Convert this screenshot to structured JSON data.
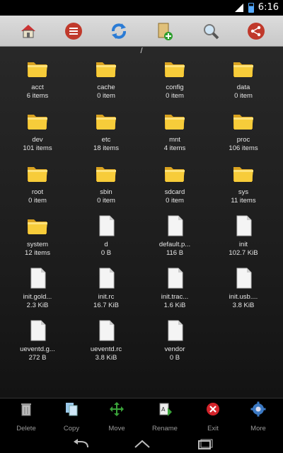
{
  "status": {
    "signal": "3G",
    "time": "6:16"
  },
  "toolbar": {
    "icons": [
      "home-icon",
      "menu-icon",
      "refresh-icon",
      "add-file-icon",
      "search-icon",
      "share-icon"
    ]
  },
  "path": "/",
  "items": [
    {
      "name": "acct",
      "info": "6 items",
      "type": "folder"
    },
    {
      "name": "cache",
      "info": "0 item",
      "type": "folder"
    },
    {
      "name": "config",
      "info": "0 item",
      "type": "folder"
    },
    {
      "name": "data",
      "info": "0 item",
      "type": "folder"
    },
    {
      "name": "dev",
      "info": "101 items",
      "type": "folder"
    },
    {
      "name": "etc",
      "info": "18 items",
      "type": "folder"
    },
    {
      "name": "mnt",
      "info": "4 items",
      "type": "folder"
    },
    {
      "name": "proc",
      "info": "106 items",
      "type": "folder"
    },
    {
      "name": "root",
      "info": "0 item",
      "type": "folder"
    },
    {
      "name": "sbin",
      "info": "0 item",
      "type": "folder"
    },
    {
      "name": "sdcard",
      "info": "0 item",
      "type": "folder"
    },
    {
      "name": "sys",
      "info": "11 items",
      "type": "folder"
    },
    {
      "name": "system",
      "info": "12 items",
      "type": "folder"
    },
    {
      "name": "d",
      "info": "0 B",
      "type": "file"
    },
    {
      "name": "default.p...",
      "info": "116 B",
      "type": "file"
    },
    {
      "name": "init",
      "info": "102.7 KiB",
      "type": "file"
    },
    {
      "name": "init.gold...",
      "info": "2.3 KiB",
      "type": "file"
    },
    {
      "name": "init.rc",
      "info": "16.7 KiB",
      "type": "file"
    },
    {
      "name": "init.trac...",
      "info": "1.6 KiB",
      "type": "file"
    },
    {
      "name": "init.usb....",
      "info": "3.8 KiB",
      "type": "file"
    },
    {
      "name": "ueventd.g...",
      "info": "272 B",
      "type": "file"
    },
    {
      "name": "ueventd.rc",
      "info": "3.8 KiB",
      "type": "file"
    },
    {
      "name": "vendor",
      "info": "0 B",
      "type": "file"
    }
  ],
  "bottom": {
    "delete": "Delete",
    "copy": "Copy",
    "move": "Move",
    "rename": "Rename",
    "exit": "Exit",
    "more": "More"
  },
  "nav": {
    "icons": [
      "back-icon",
      "home-icon",
      "recents-icon"
    ]
  }
}
